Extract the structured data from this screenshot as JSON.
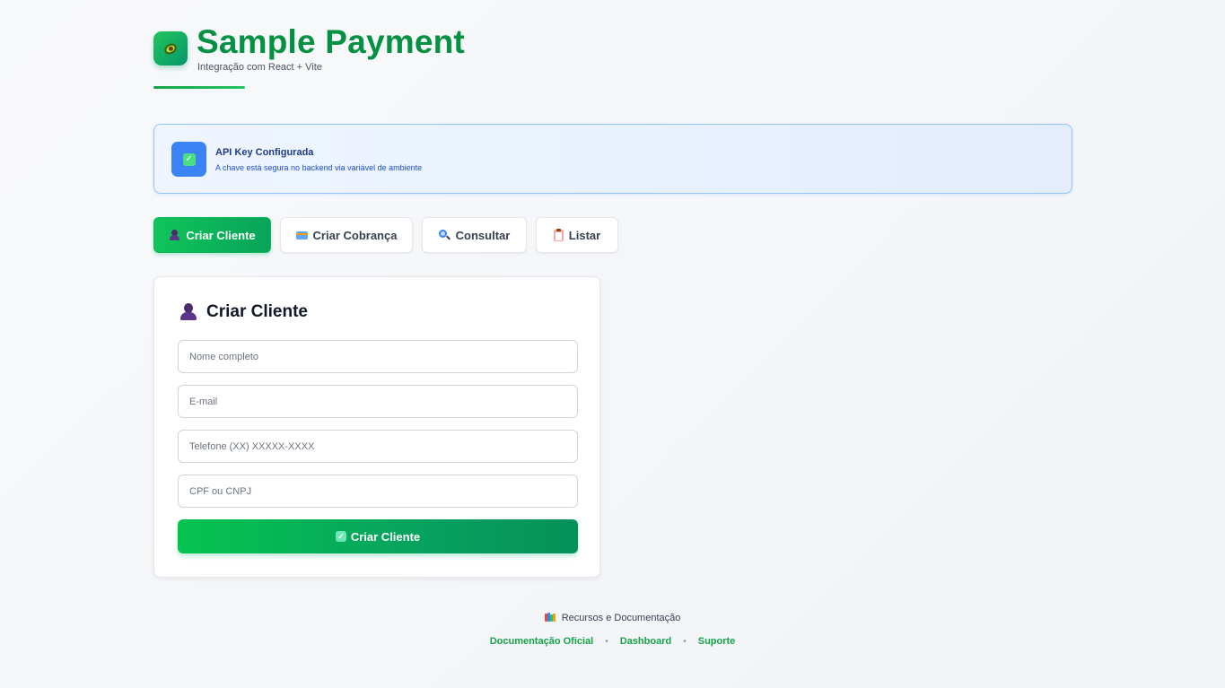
{
  "header": {
    "title": "Sample Payment",
    "subtitle": "Integração com React + Vite",
    "logo_icon": "avocado-icon"
  },
  "banner": {
    "title": "API Key Configurada",
    "description": "A chave está segura no backend via variável de ambiente",
    "icon": "check-icon"
  },
  "tabs": [
    {
      "label": "Criar Cliente",
      "icon": "person-icon",
      "active": true
    },
    {
      "label": "Criar Cobrança",
      "icon": "credit-card-icon",
      "active": false
    },
    {
      "label": "Consultar",
      "icon": "magnifier-icon",
      "active": false
    },
    {
      "label": "Listar",
      "icon": "clipboard-icon",
      "active": false
    }
  ],
  "form": {
    "title": "Criar Cliente",
    "fields": {
      "name": {
        "placeholder": "Nome completo",
        "value": ""
      },
      "email": {
        "placeholder": "E-mail",
        "value": ""
      },
      "phone": {
        "placeholder": "Telefone (XX) XXXXX-XXXX",
        "value": ""
      },
      "document": {
        "placeholder": "CPF ou CNPJ",
        "value": ""
      }
    },
    "submit_label": "Criar Cliente"
  },
  "footer": {
    "title": "Recursos e Documentação",
    "links": [
      "Documentação Oficial",
      "Dashboard",
      "Suporte"
    ],
    "separator": "•"
  },
  "colors": {
    "brand_green": "#059142",
    "accent_blue": "#3b82f6",
    "link_green": "#16a34a"
  }
}
